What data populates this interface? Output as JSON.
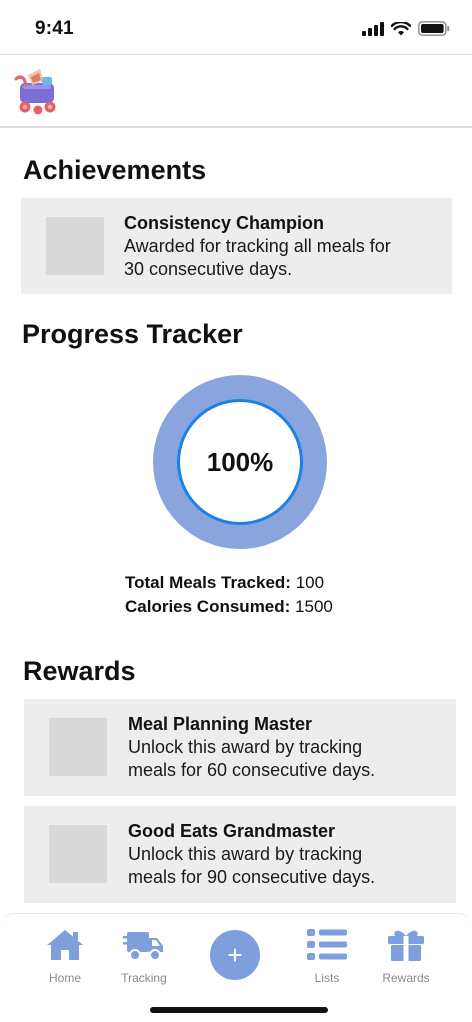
{
  "status_bar": {
    "time": "9:41"
  },
  "achievements": {
    "title": "Achievements",
    "items": [
      {
        "title": "Consistency Champion",
        "desc_line1": "Awarded for tracking all meals for",
        "desc_line2": "30 consecutive days."
      }
    ]
  },
  "progress": {
    "title": "Progress Tracker",
    "percent_label": "100%",
    "percent_value": 100,
    "total_meals_label": "Total Meals Tracked:",
    "total_meals_value": "100",
    "calories_label": "Calories Consumed:",
    "calories_value": "1500"
  },
  "rewards": {
    "title": "Rewards",
    "items": [
      {
        "title": "Meal Planning Master",
        "desc_line1": "Unlock this award by tracking",
        "desc_line2": "meals for 60 consecutive days."
      },
      {
        "title": "Good Eats Grandmaster",
        "desc_line1": "Unlock this award by tracking",
        "desc_line2": "meals for 90 consecutive days."
      }
    ]
  },
  "nav": {
    "items": [
      {
        "label": "Home",
        "icon": "home-icon"
      },
      {
        "label": "Tracking",
        "icon": "truck-icon"
      },
      {
        "label": "+",
        "icon": "plus-icon"
      },
      {
        "label": "Lists",
        "icon": "list-icon"
      },
      {
        "label": "Rewards",
        "icon": "gift-icon"
      }
    ]
  },
  "colors": {
    "accent": "#7e9fdc",
    "ring": "#8aa5de",
    "ring_border": "#1b82e3",
    "card_bg": "#ededed"
  }
}
